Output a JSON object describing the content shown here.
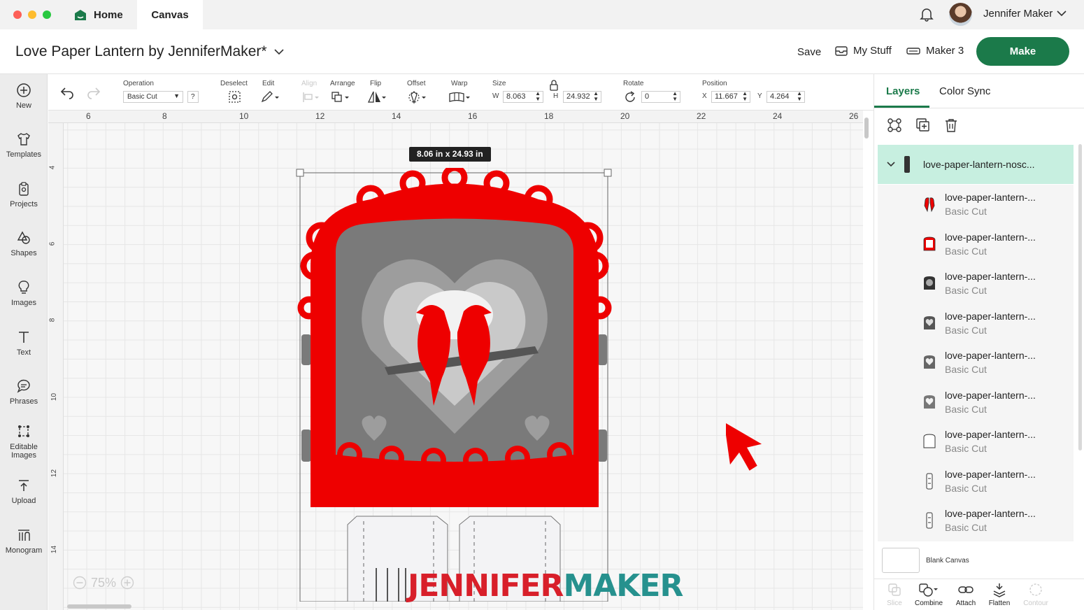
{
  "titlebar": {
    "tabs": [
      {
        "label": "Home"
      },
      {
        "label": "Canvas"
      }
    ],
    "user": {
      "name": "Jennifer Maker"
    }
  },
  "header": {
    "project_title": "Love Paper Lantern by JenniferMaker*",
    "save_label": "Save",
    "mystuff_label": "My Stuff",
    "machine_label": "Maker 3",
    "make_label": "Make"
  },
  "rail": {
    "items": [
      {
        "label": "New",
        "icon": "plus-circle-icon"
      },
      {
        "label": "Templates",
        "icon": "shirt-icon"
      },
      {
        "label": "Projects",
        "icon": "clipboard-icon"
      },
      {
        "label": "Shapes",
        "icon": "shapes-icon"
      },
      {
        "label": "Images",
        "icon": "lightbulb-icon"
      },
      {
        "label": "Text",
        "icon": "text-icon"
      },
      {
        "label": "Phrases",
        "icon": "speech-bubble-icon"
      },
      {
        "label": "Editable",
        "label2": "Images",
        "icon": "editable-images-icon"
      },
      {
        "label": "Upload",
        "icon": "upload-icon"
      },
      {
        "label": "Monogram",
        "icon": "monogram-icon"
      }
    ]
  },
  "toolbar": {
    "operation_label": "Operation",
    "operation_value": "Basic Cut",
    "help": "?",
    "deselect_label": "Deselect",
    "edit_label": "Edit",
    "align_label": "Align",
    "arrange_label": "Arrange",
    "flip_label": "Flip",
    "offset_label": "Offset",
    "warp_label": "Warp",
    "size_label": "Size",
    "w_label": "W",
    "w_value": "8.063",
    "h_label": "H",
    "h_value": "24.932",
    "rotate_label": "Rotate",
    "rotate_value": "0",
    "position_label": "Position",
    "x_label": "X",
    "x_value": "11.667",
    "y_label": "Y",
    "y_value": "4.264"
  },
  "canvas": {
    "ruler_top": [
      "6",
      "8",
      "10",
      "12",
      "14",
      "16",
      "18",
      "20",
      "22",
      "24",
      "26"
    ],
    "ruler_left": [
      "4",
      "6",
      "8",
      "10",
      "12",
      "14"
    ],
    "dimension_label": "8.06  in x 24.93  in",
    "zoom": "75%",
    "watermark_a": "JENNIFER",
    "watermark_b": "MAKER",
    "colors": {
      "primary": "#ee0000",
      "gray": "#7a7a7a",
      "accent": "#1b7a4a"
    }
  },
  "panel": {
    "tabs": [
      {
        "label": "Layers"
      },
      {
        "label": "Color Sync"
      }
    ],
    "group": {
      "name": "love-paper-lantern-nosc..."
    },
    "layers": [
      {
        "name": "love-paper-lantern-...",
        "op": "Basic Cut",
        "thumb": "red-birds"
      },
      {
        "name": "love-paper-lantern-...",
        "op": "Basic Cut",
        "thumb": "red-frame"
      },
      {
        "name": "love-paper-lantern-...",
        "op": "Basic Cut",
        "thumb": "gray-dark"
      },
      {
        "name": "love-paper-lantern-...",
        "op": "Basic Cut",
        "thumb": "gray-heart"
      },
      {
        "name": "love-paper-lantern-...",
        "op": "Basic Cut",
        "thumb": "gray-heart"
      },
      {
        "name": "love-paper-lantern-...",
        "op": "Basic Cut",
        "thumb": "gray-heart"
      },
      {
        "name": "love-paper-lantern-...",
        "op": "Basic Cut",
        "thumb": "outline"
      },
      {
        "name": "love-paper-lantern-...",
        "op": "Basic Cut",
        "thumb": "strip"
      },
      {
        "name": "love-paper-lantern-...",
        "op": "Basic Cut",
        "thumb": "strip"
      }
    ],
    "blank_canvas_label": "Blank Canvas",
    "bottom_buttons": [
      {
        "label": "Slice",
        "enabled": false
      },
      {
        "label": "Combine",
        "enabled": true
      },
      {
        "label": "Attach",
        "enabled": true
      },
      {
        "label": "Flatten",
        "enabled": true
      },
      {
        "label": "Contour",
        "enabled": false
      }
    ]
  }
}
